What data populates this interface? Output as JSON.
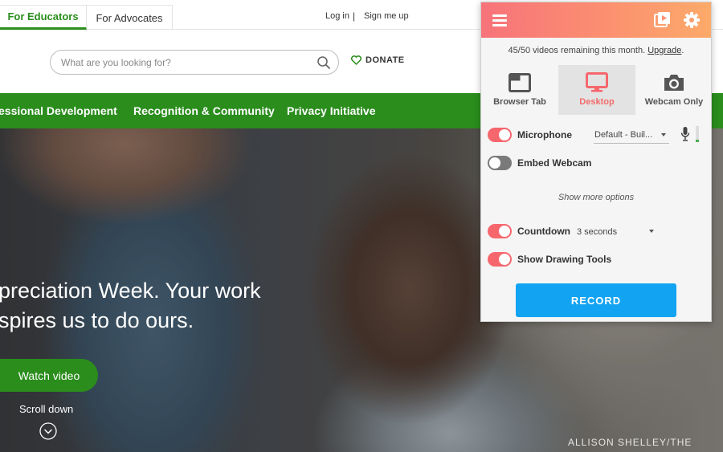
{
  "site": {
    "audience_tabs": [
      "For Educators",
      "For Advocates"
    ],
    "auth": {
      "login": "Log in",
      "separator": "|",
      "signup": "Sign me up"
    },
    "search": {
      "placeholder": "What are you looking for?"
    },
    "donate": "DONATE",
    "nav": [
      "essional Development",
      "Recognition & Community",
      "Privacy Initiative"
    ],
    "hero": {
      "headline_line1": "preciation Week. Your work",
      "headline_line2": "spires us to do ours.",
      "watch_button": "Watch video",
      "scroll_label": "Scroll down",
      "photo_credit": "ALLISON SHELLEY/THE"
    },
    "colors": {
      "brand_green": "#2a8d1c"
    }
  },
  "extension": {
    "quota_text": "45/50 videos remaining this month.",
    "upgrade_link": "Upgrade",
    "upgrade_suffix": ".",
    "modes": [
      {
        "label": "Browser Tab",
        "icon": "browser-tab-icon",
        "selected": false
      },
      {
        "label": "Desktop",
        "icon": "monitor-icon",
        "selected": true
      },
      {
        "label": "Webcam Only",
        "icon": "camera-icon",
        "selected": false
      }
    ],
    "microphone": {
      "label": "Microphone",
      "enabled": true,
      "device": "Default - Buil..."
    },
    "embed_webcam": {
      "label": "Embed Webcam",
      "enabled": false
    },
    "more_options": "Show more options",
    "countdown": {
      "label": "Countdown",
      "enabled": true,
      "value": "3 seconds"
    },
    "drawing_tools": {
      "label": "Show Drawing Tools",
      "enabled": true
    },
    "record_button": "RECORD",
    "colors": {
      "accent": "#f6676d",
      "record_blue": "#12a4f2"
    }
  }
}
